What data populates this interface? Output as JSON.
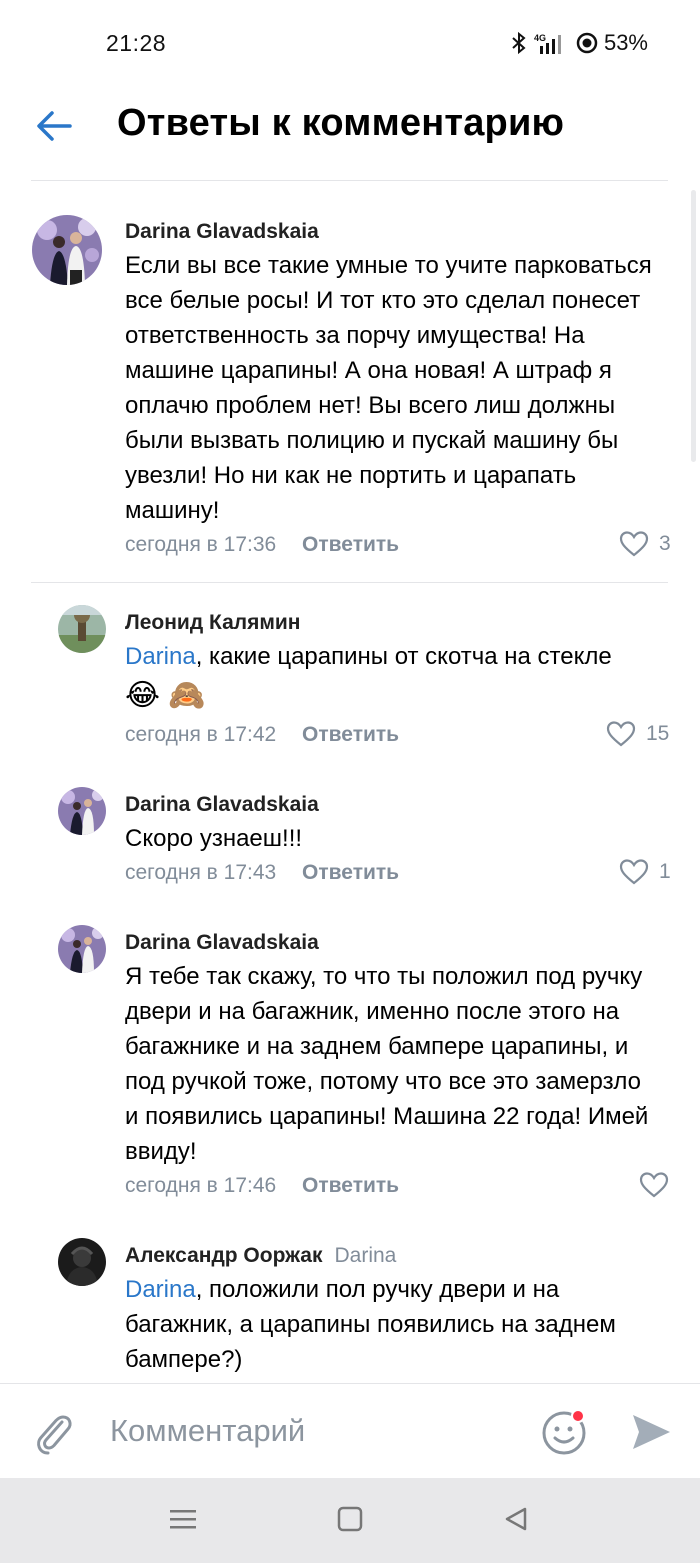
{
  "status": {
    "time": "21:28",
    "network": "4G",
    "battery": "53%"
  },
  "header": {
    "title": "Ответы к комментарию"
  },
  "comments": [
    {
      "author": "Darina Glavadskaia",
      "text": "Если вы все такие умные то учите парковаться все белые росы! И тот кто это сделал понесет ответственность за порчу имущества! На машине царапины! А она новая! А штраф я оплачю проблем нет! Вы всего лиш должны были вызвать полицию и пускай машину бы увезли! Но ни как не портить и царапать машину!",
      "time": "сегодня в 17:36",
      "reply": "Ответить",
      "likes": "3"
    },
    {
      "author": "Леонид Калямин",
      "mention": "Darina",
      "text": ", какие царапины от скотча на стекле",
      "emoji": "😂 🙈",
      "time": "сегодня в 17:42",
      "reply": "Ответить",
      "likes": "15"
    },
    {
      "author": "Darina Glavadskaia",
      "text": "Скоро узнаеш!!!",
      "time": "сегодня в 17:43",
      "reply": "Ответить",
      "likes": "1"
    },
    {
      "author": "Darina Glavadskaia",
      "text": "Я тебе так скажу, то что ты положил под ручку двери и на багажник, именно после этого на багажнике и на заднем бампере царапины, и под ручкой тоже, потому что все это замерзло и появились царапины! Машина 22 года! Имей ввиду!",
      "time": "сегодня в 17:46",
      "reply": "Ответить",
      "likes": ""
    },
    {
      "author": "Александр Ооржак",
      "reply_to": "Darina",
      "mention": "Darina",
      "text": ", положили пол ручку двери и на багажник, а царапины появились на заднем бампере?)"
    }
  ],
  "input": {
    "placeholder": "Комментарий"
  },
  "colors": {
    "accent": "#2a77c9",
    "secondary": "#818c99",
    "divider": "#e4e5e8"
  },
  "icons": [
    "back-arrow-icon",
    "heart-icon",
    "attach-icon",
    "emoji-icon",
    "send-icon",
    "menu-icon",
    "home-icon",
    "back-icon"
  ]
}
